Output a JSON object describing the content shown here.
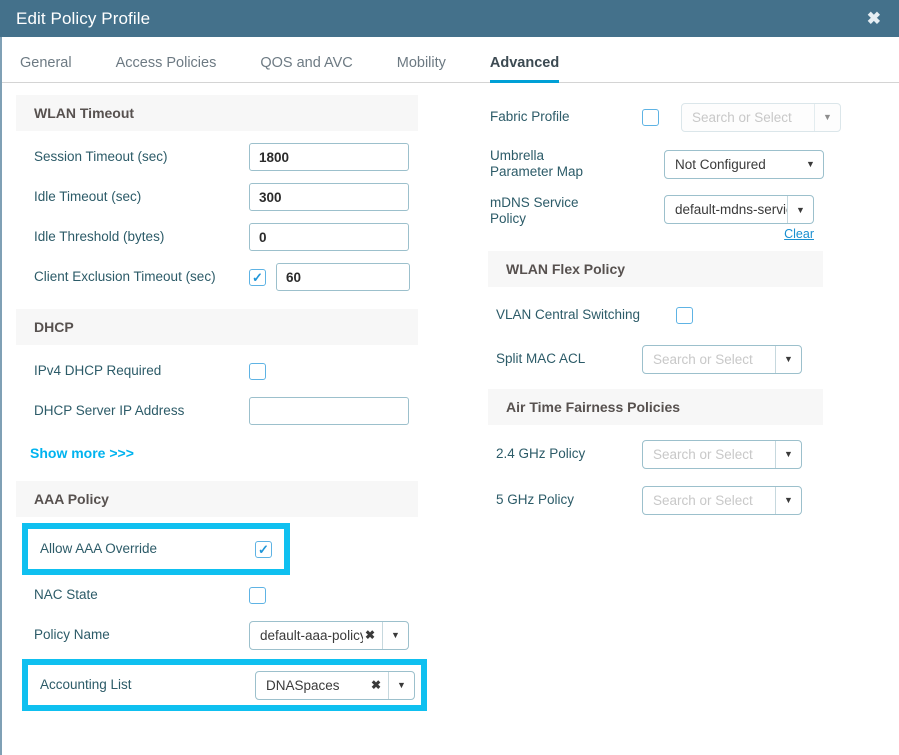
{
  "window": {
    "title": "Edit Policy Profile",
    "close_icon": "close-icon",
    "header_color": "#44718b",
    "accent_color": "#00a0d6",
    "highlight_color": "#0fc0f0"
  },
  "tabs": [
    {
      "label": "General",
      "active": false
    },
    {
      "label": "Access Policies",
      "active": false
    },
    {
      "label": "QOS and AVC",
      "active": false
    },
    {
      "label": "Mobility",
      "active": false
    },
    {
      "label": "Advanced",
      "active": true
    }
  ],
  "left_column": {
    "wlan_timeout": {
      "section_title": "WLAN Timeout",
      "session_timeout": {
        "label": "Session Timeout (sec)",
        "value": "1800"
      },
      "idle_timeout": {
        "label": "Idle Timeout (sec)",
        "value": "300"
      },
      "idle_threshold": {
        "label": "Idle Threshold (bytes)",
        "value": "0"
      },
      "client_exclusion_timeout": {
        "label": "Client Exclusion Timeout (sec)",
        "checked": true,
        "value": "60"
      }
    },
    "dhcp": {
      "section_title": "DHCP",
      "ipv4_dhcp_required": {
        "label": "IPv4 DHCP Required",
        "checked": false
      },
      "dhcp_server_ip": {
        "label": "DHCP Server IP Address",
        "value": ""
      }
    },
    "show_more": {
      "label": "Show more >>>"
    },
    "aaa_policy": {
      "section_title": "AAA Policy",
      "allow_aaa_override": {
        "label": "Allow AAA Override",
        "checked": true,
        "highlighted": true
      },
      "nac_state": {
        "label": "NAC State",
        "checked": false,
        "highlighted": false
      },
      "policy_name": {
        "label": "Policy Name",
        "value": "default-aaa-policy",
        "highlighted": false
      },
      "accounting_list": {
        "label": "Accounting List",
        "value": "DNASpaces",
        "highlighted": true
      }
    }
  },
  "right_column": {
    "fabric_profile": {
      "label": "Fabric Profile",
      "checked": false,
      "value": "",
      "placeholder": "Search or Select",
      "disabled": true
    },
    "umbrella_parameter_map": {
      "label_line1": "Umbrella",
      "label_line2": "Parameter Map",
      "value": "Not Configured"
    },
    "mdns_service_policy": {
      "label_line1": "mDNS Service",
      "label_line2": "Policy",
      "value": "default-mdns-servic",
      "clear_label": "Clear"
    },
    "wlan_flex_policy": {
      "section_title": "WLAN Flex Policy",
      "vlan_central_switching": {
        "label": "VLAN Central Switching",
        "checked": false
      },
      "split_mac_acl": {
        "label": "Split MAC ACL",
        "value": "",
        "placeholder": "Search or Select"
      }
    },
    "air_time_fairness": {
      "section_title": "Air Time Fairness Policies",
      "policy_24ghz": {
        "label": "2.4 GHz Policy",
        "value": "",
        "placeholder": "Search or Select"
      },
      "policy_5ghz": {
        "label": "5 GHz Policy",
        "value": "",
        "placeholder": "Search or Select"
      }
    }
  },
  "glyphs": {
    "caret_down": "▼",
    "check": "✓",
    "clear_x": "✖",
    "close": "✖"
  }
}
